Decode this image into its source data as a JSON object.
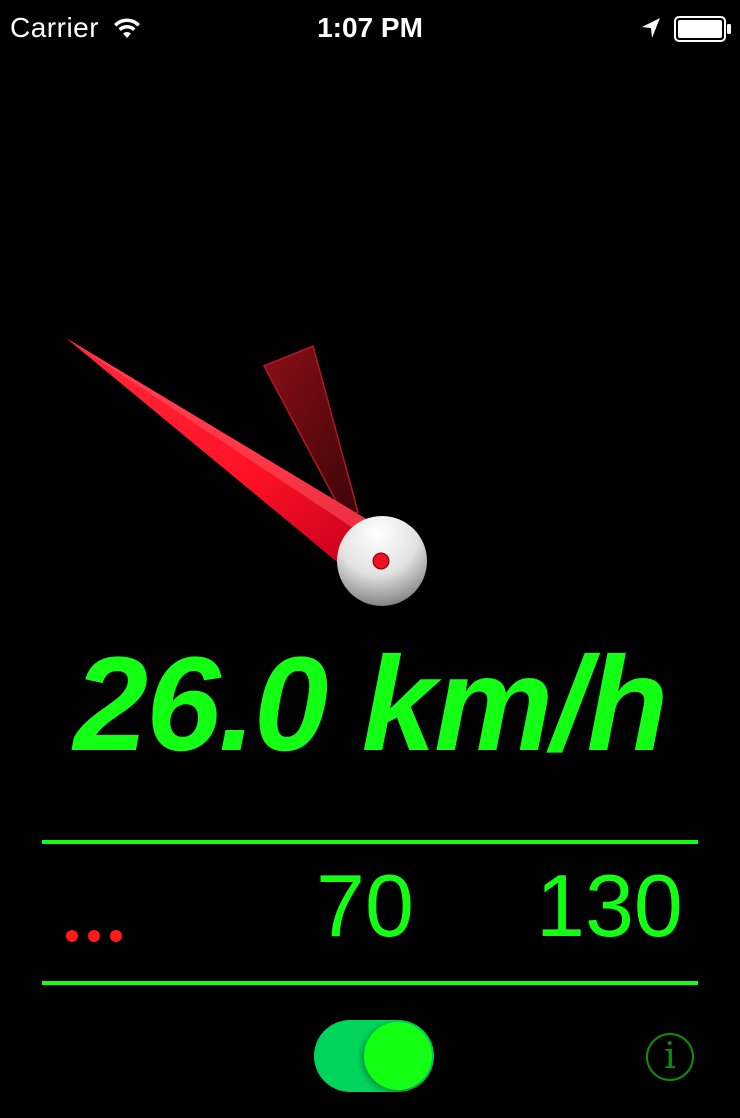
{
  "status_bar": {
    "carrier": "Carrier",
    "time": "1:07 PM",
    "icons": [
      "wifi-icon",
      "location-arrow-icon",
      "battery-icon"
    ]
  },
  "speed": {
    "display": "26.0 km/h",
    "value": 26.0,
    "unit": "km/h"
  },
  "limits": {
    "indicator_dots": 3,
    "current": "70",
    "max": "130"
  },
  "toggle": {
    "on": true
  },
  "info_button": {
    "label": "i"
  },
  "colors": {
    "background": "#000000",
    "accent_green": "#13ff13",
    "toggle_track": "#00d45a",
    "needle_red": "#ff1a2e",
    "info_green": "#0a8f0a"
  }
}
